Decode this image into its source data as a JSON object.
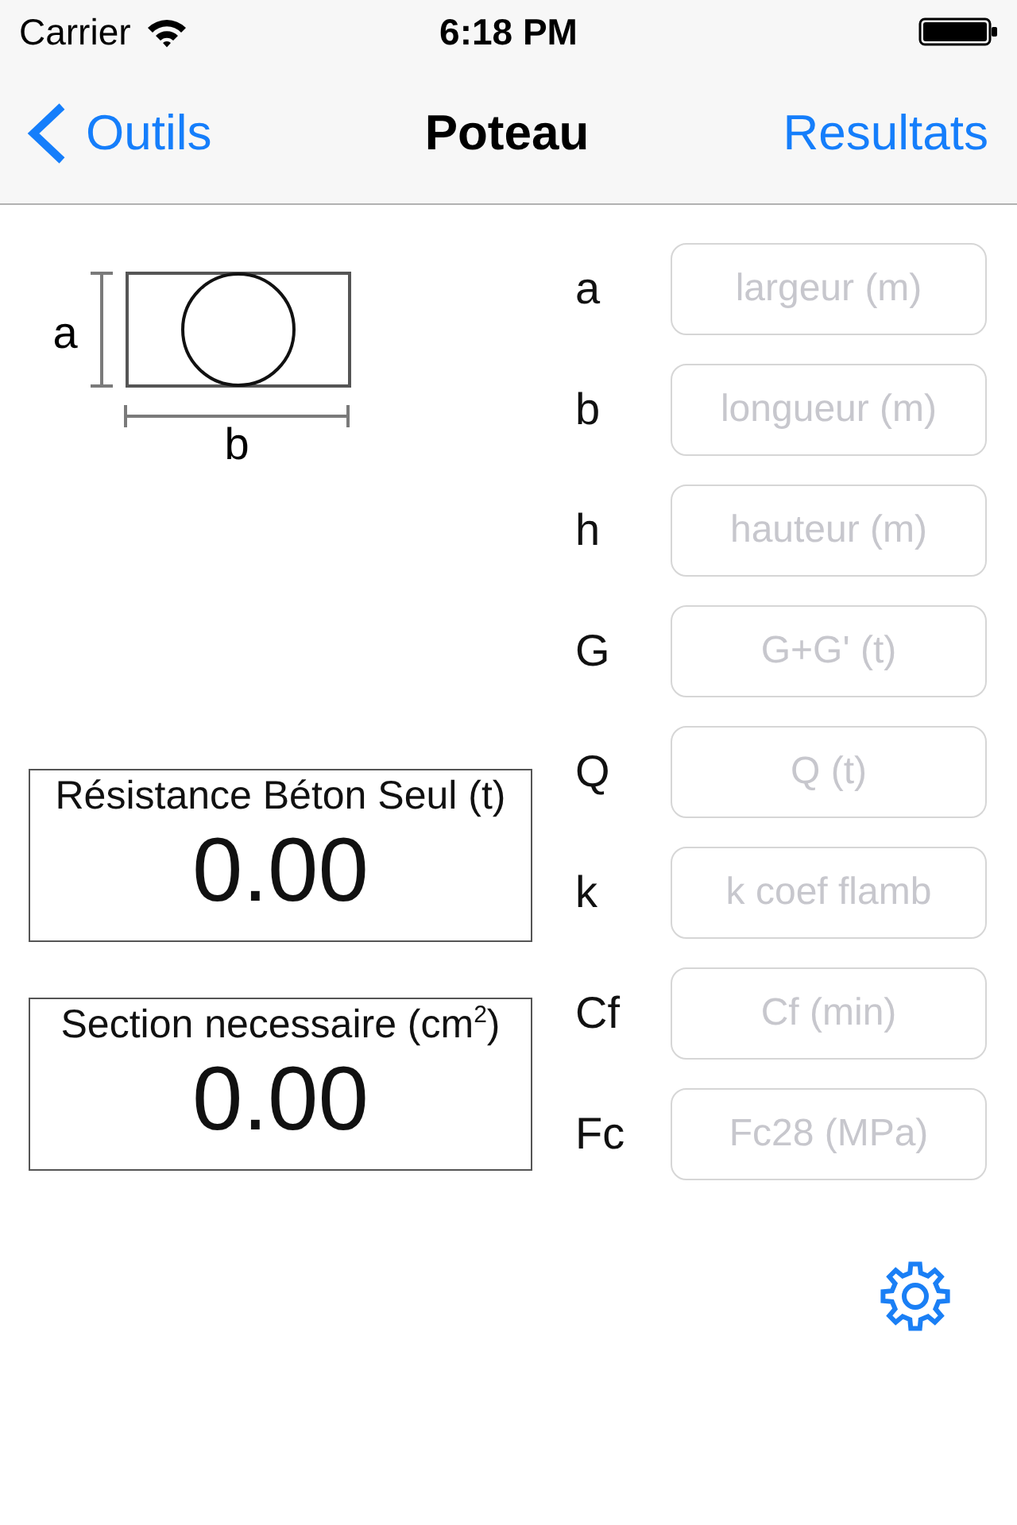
{
  "status_bar": {
    "carrier": "Carrier",
    "time": "6:18 PM"
  },
  "nav_bar": {
    "back": "Outils",
    "title": "Poteau",
    "action": "Resultats"
  },
  "diagram": {
    "height_label": "a",
    "width_label": "b"
  },
  "results": [
    {
      "title": "Résistance Béton Seul (t)",
      "value": "0.00"
    },
    {
      "title": "Section necessaire (cm$^{2}$)",
      "value": "0.00"
    }
  ],
  "inputs": [
    {
      "label": "a",
      "placeholder": "largeur (m)"
    },
    {
      "label": "b",
      "placeholder": "longueur (m)"
    },
    {
      "label": "h",
      "placeholder": "hauteur (m)"
    },
    {
      "label": "G",
      "placeholder": "G+G' (t)"
    },
    {
      "label": "Q",
      "placeholder": "Q (t)"
    },
    {
      "label": "k",
      "placeholder": "k coef flamb"
    },
    {
      "label": "Cf",
      "placeholder": "Cf (min)"
    },
    {
      "label": "Fc",
      "placeholder": "Fc28 (MPa)"
    }
  ]
}
